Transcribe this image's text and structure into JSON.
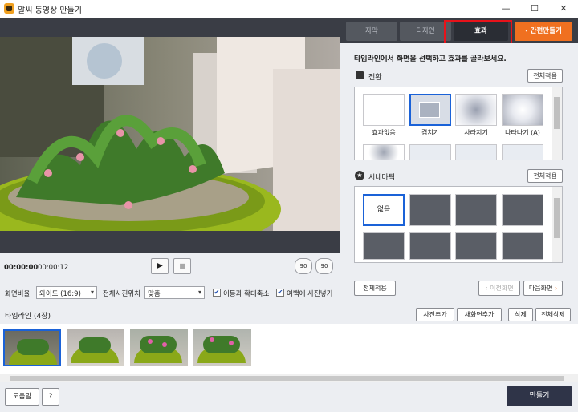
{
  "window": {
    "title": "알씨 동영상 만들기",
    "minimize": "—",
    "maximize": "☐",
    "close": "✕"
  },
  "player": {
    "current_time": "00:00:00",
    "total_time": "00:00:12",
    "play_icon": "▶",
    "stop_icon": "■",
    "rotate_left": "90",
    "rotate_right": "90"
  },
  "settings": {
    "aspect_label": "화면비율",
    "aspect_value": "와이드 (16:9)",
    "position_label": "전체사진위치",
    "position_value": "맞춤",
    "pan_zoom_label": "이동과 확대축소",
    "margin_photo_label": "여백에 사진넣기"
  },
  "tabs": [
    {
      "label": "자막"
    },
    {
      "label": "디자인"
    },
    {
      "label": "효과"
    }
  ],
  "simple_make_label": "간편만들기",
  "instruction": "타임라인에서 화면을 선택하고 효과를 골라보세요.",
  "transition": {
    "title": "전환",
    "apply_all": "전체적용",
    "items": [
      {
        "label": "효과없음"
      },
      {
        "label": "겹치기"
      },
      {
        "label": "사라지기"
      },
      {
        "label": "나타나기 (A)"
      }
    ]
  },
  "cinematic": {
    "title": "시네마틱",
    "apply_all": "전체적용",
    "none_label": "없음"
  },
  "panel_footer": {
    "apply_all": "전체적용",
    "prev": "이전화면",
    "next": "다음화면"
  },
  "timeline": {
    "title": "타임라인 (4장)",
    "add_photo": "사진추가",
    "add_new_screen": "새화면추가",
    "delete": "삭제",
    "delete_all": "전체삭제"
  },
  "footer": {
    "help": "도움말",
    "question": "?",
    "make": "만들기"
  },
  "colors": {
    "accent_orange": "#f07020",
    "highlight_red": "#e8121a",
    "selected_blue": "#1a62d8",
    "dark_bar": "#3a3d45",
    "make_button": "#2f3448"
  }
}
